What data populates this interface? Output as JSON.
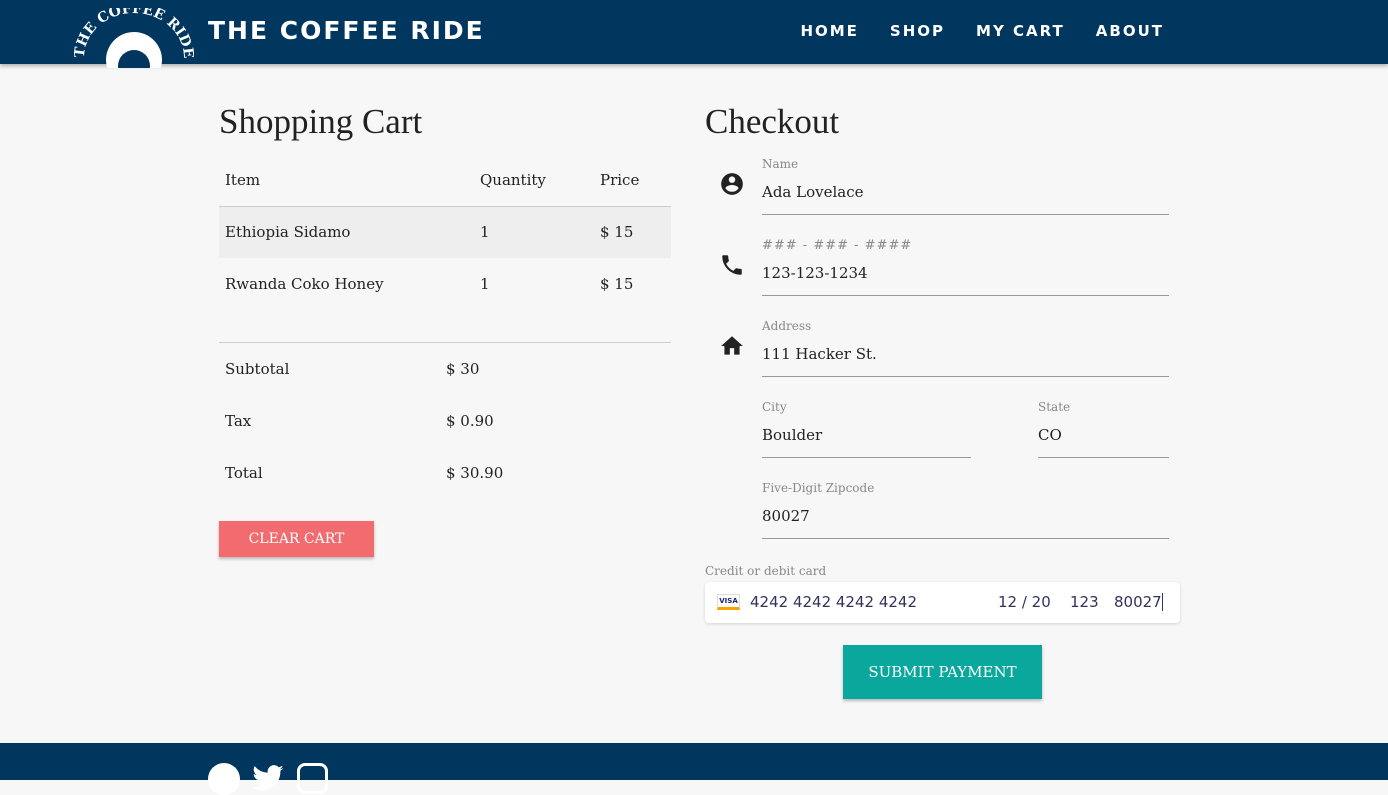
{
  "header": {
    "logo_text": "THE COFFEE RIDE",
    "brand": "THE COFFEE RIDE",
    "nav": [
      "HOME",
      "SHOP",
      "MY CART",
      "ABOUT"
    ]
  },
  "cart": {
    "title": "Shopping Cart",
    "columns": [
      "Item",
      "Quantity",
      "Price"
    ],
    "rows": [
      {
        "item": "Ethiopia Sidamo",
        "qty": "1",
        "price": "$ 15"
      },
      {
        "item": "Rwanda Coko Honey",
        "qty": "1",
        "price": "$ 15"
      }
    ],
    "subtotal_label": "Subtotal",
    "subtotal": "$ 30",
    "tax_label": "Tax",
    "tax": "$ 0.90",
    "total_label": "Total",
    "total": "$ 30.90",
    "clear_label": "CLEAR CART"
  },
  "checkout": {
    "title": "Checkout",
    "name_label": "Name",
    "name": "Ada Lovelace",
    "phone_placeholder": "### - ### - ####",
    "phone": "123-123-1234",
    "address_label": "Address",
    "address": "111 Hacker St.",
    "city_label": "City",
    "city": "Boulder",
    "state_label": "State",
    "state": "CO",
    "zip_label": "Five-Digit Zipcode",
    "zip": "80027",
    "card_label": "Credit or debit card",
    "card_brand": "VISA",
    "card_number": "4242 4242 4242 4242",
    "card_exp": "12 / 20",
    "card_cvc": "123",
    "card_zip": "80027",
    "submit_label": "SUBMIT PAYMENT"
  },
  "footer": {
    "icons": [
      "facebook-icon",
      "twitter-icon",
      "instagram-icon"
    ]
  }
}
